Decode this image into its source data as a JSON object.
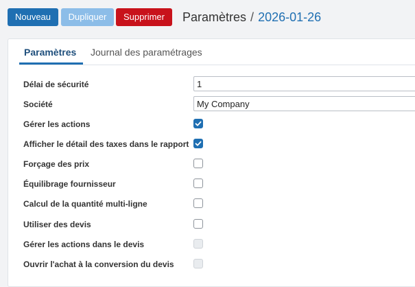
{
  "toolbar": {
    "new_label": "Nouveau",
    "duplicate_label": "Dupliquer",
    "delete_label": "Supprimer"
  },
  "breadcrumb": {
    "parent": "Paramètres",
    "separator": "/",
    "current": "2026-01-26"
  },
  "tabs": [
    {
      "label": "Paramètres",
      "active": true
    },
    {
      "label": "Journal des paramétrages",
      "active": false
    }
  ],
  "fields": {
    "security_delay": {
      "label": "Délai de sécurité",
      "value": "1"
    },
    "company": {
      "label": "Société",
      "value": "My Company"
    }
  },
  "checkboxes": [
    {
      "label": "Gérer les actions",
      "state": "checked"
    },
    {
      "label": "Afficher le détail des taxes dans le rapport",
      "state": "checked"
    },
    {
      "label": "Forçage des prix",
      "state": "unchecked"
    },
    {
      "label": "Équilibrage fournisseur",
      "state": "unchecked"
    },
    {
      "label": "Calcul de la quantité multi-ligne",
      "state": "unchecked"
    },
    {
      "label": "Utiliser des devis",
      "state": "unchecked"
    },
    {
      "label": "Gérer les actions dans le devis",
      "state": "disabled"
    },
    {
      "label": "Ouvrir l'achat à la conversion du devis",
      "state": "disabled"
    }
  ],
  "colors": {
    "primary": "#1f6fb2",
    "primary_light": "#8cbde8",
    "danger": "#c8121b"
  }
}
